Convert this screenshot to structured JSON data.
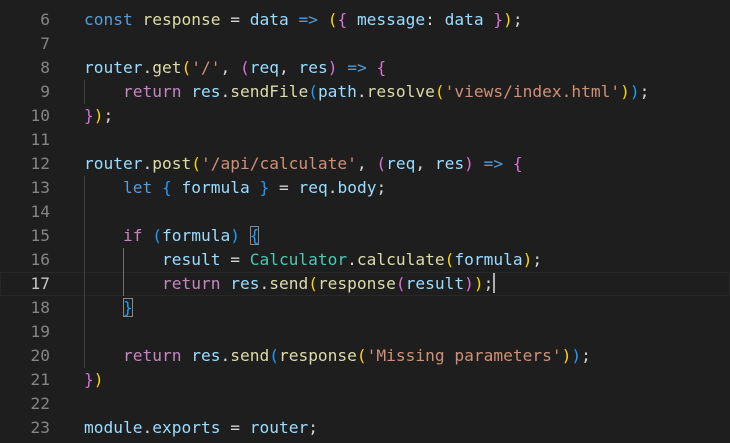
{
  "editor": {
    "language": "javascript",
    "theme": "dark",
    "current_line": "17",
    "lines": [
      {
        "number": "6",
        "text": "const response = data => ({ message: data });"
      },
      {
        "number": "7",
        "text": ""
      },
      {
        "number": "8",
        "text": "router.get('/', (req, res) => {"
      },
      {
        "number": "9",
        "text": "    return res.sendFile(path.resolve('views/index.html'));"
      },
      {
        "number": "10",
        "text": "});"
      },
      {
        "number": "11",
        "text": ""
      },
      {
        "number": "12",
        "text": "router.post('/api/calculate', (req, res) => {"
      },
      {
        "number": "13",
        "text": "    let { formula } = req.body;"
      },
      {
        "number": "14",
        "text": ""
      },
      {
        "number": "15",
        "text": "    if (formula) {"
      },
      {
        "number": "16",
        "text": "        result = Calculator.calculate(formula);"
      },
      {
        "number": "17",
        "text": "        return res.send(response(result));"
      },
      {
        "number": "18",
        "text": "    }"
      },
      {
        "number": "19",
        "text": ""
      },
      {
        "number": "20",
        "text": "    return res.send(response('Missing parameters'));"
      },
      {
        "number": "21",
        "text": "})"
      },
      {
        "number": "22",
        "text": ""
      },
      {
        "number": "23",
        "text": "module.exports = router;"
      }
    ]
  },
  "colors": {
    "background": "#1e1e1e",
    "keyword": "#569cd6",
    "control": "#c586c0",
    "variable": "#9cdcfe",
    "class": "#4ec9b0",
    "function": "#dcdcaa",
    "string": "#ce9178",
    "bracket_1": "#ffd700",
    "bracket_2": "#da70d6",
    "bracket_3": "#179fff"
  }
}
